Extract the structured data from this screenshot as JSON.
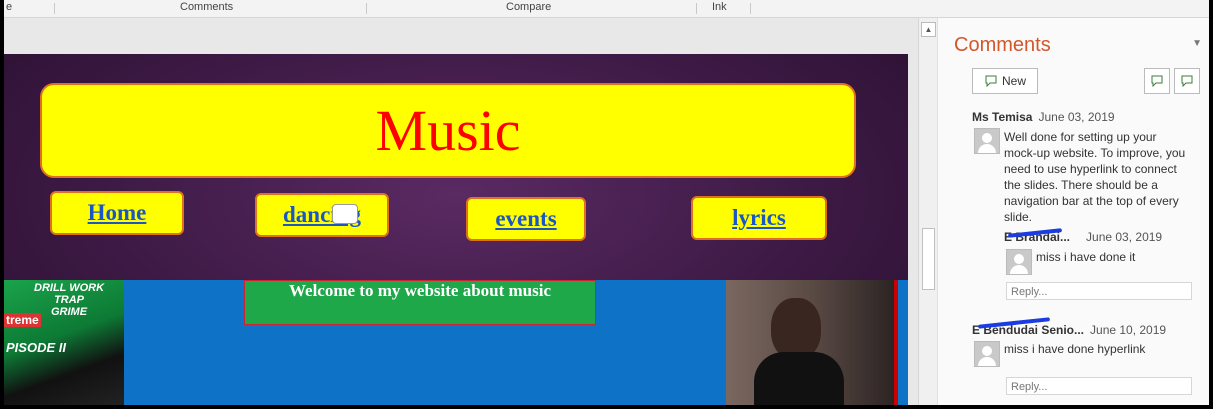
{
  "ribbon": {
    "items": [
      "e",
      "Comments",
      "Compare",
      "Ink"
    ]
  },
  "slide": {
    "title": "Music",
    "nav": [
      "Home",
      "dancing",
      "events",
      "lyrics"
    ],
    "welcome": "Welcome to my website about music",
    "left_image_text": {
      "line1": "DRILL WORK",
      "line2": "TRAP",
      "line3": "GRIME",
      "badge": "treme",
      "episode": "PISODE II"
    }
  },
  "comments_pane": {
    "title": "Comments",
    "new_label": "New",
    "threads": [
      {
        "author": "Ms Temisa",
        "date": "June 03, 2019",
        "text": "Well done for setting up your mock-up website. To improve, you need to use hyperlink to connect the slides. There should be a navigation bar at the top of every slide.",
        "reply": {
          "author": "E  Brandai...",
          "date": "June 03, 2019",
          "text": "miss i have done it"
        },
        "reply_placeholder": "Reply..."
      },
      {
        "author": "E  Bendudai Senio...",
        "date": "June 10, 2019",
        "text": "miss i have done hyperlink",
        "reply_placeholder": "Reply..."
      }
    ]
  },
  "colors": {
    "accent": "#d2572b",
    "title_box": "#ffff00",
    "title_text": "#ff0000",
    "link": "#1a56c4",
    "welcome_bg": "#1fa84a",
    "band_bg": "#0e72c7"
  }
}
